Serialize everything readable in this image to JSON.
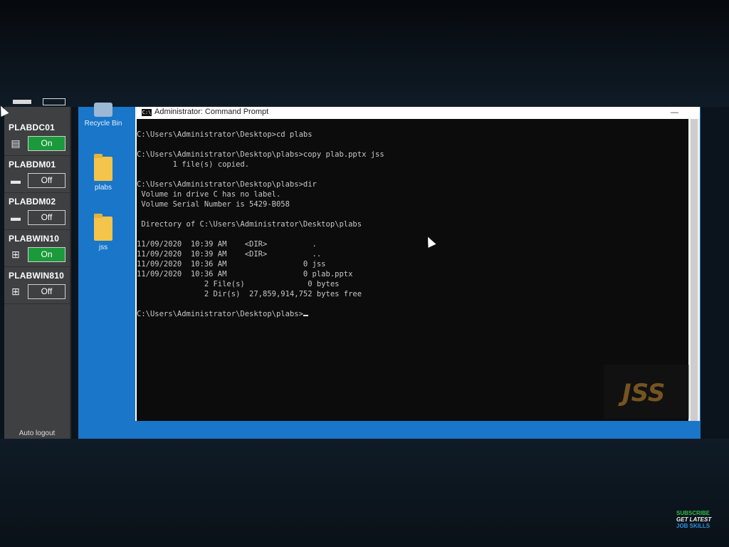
{
  "machines": [
    {
      "name": "PLABDC01",
      "state": "On",
      "icon": "server-book-icon"
    },
    {
      "name": "PLABDM01",
      "state": "Off",
      "icon": "drive-icon"
    },
    {
      "name": "PLABDM02",
      "state": "Off",
      "icon": "drive-icon"
    },
    {
      "name": "PLABWIN10",
      "state": "On",
      "icon": "windows-pc-icon"
    },
    {
      "name": "PLABWIN810",
      "state": "Off",
      "icon": "windows-pc-icon"
    }
  ],
  "panel": {
    "auto_logout": "Auto logout"
  },
  "desktop": {
    "recycle_bin": "Recycle Bin",
    "folder1": "plabs",
    "folder2": "jss"
  },
  "window": {
    "title": "Administrator: Command Prompt",
    "app_icon": "C:\\"
  },
  "console_lines": [
    "C:\\Users\\Administrator\\Desktop>cd plabs",
    "",
    "C:\\Users\\Administrator\\Desktop\\plabs>copy plab.pptx jss",
    "        1 file(s) copied.",
    "",
    "C:\\Users\\Administrator\\Desktop\\plabs>dir",
    " Volume in drive C has no label.",
    " Volume Serial Number is 5429-B058",
    "",
    " Directory of C:\\Users\\Administrator\\Desktop\\plabs",
    "",
    "11/09/2020  10:39 AM    <DIR>          .",
    "11/09/2020  10:39 AM    <DIR>          ..",
    "11/09/2020  10:36 AM                 0 jss",
    "11/09/2020  10:36 AM                 0 plab.pptx",
    "               2 File(s)              0 bytes",
    "               2 Dir(s)  27,859,914,752 bytes free",
    "",
    "C:\\Users\\Administrator\\Desktop\\plabs>"
  ],
  "watermark": "JSS",
  "promo": {
    "line1": "SUBSCRIBE",
    "line2": "GET LATEST",
    "line3": "JOB SKILLS"
  }
}
